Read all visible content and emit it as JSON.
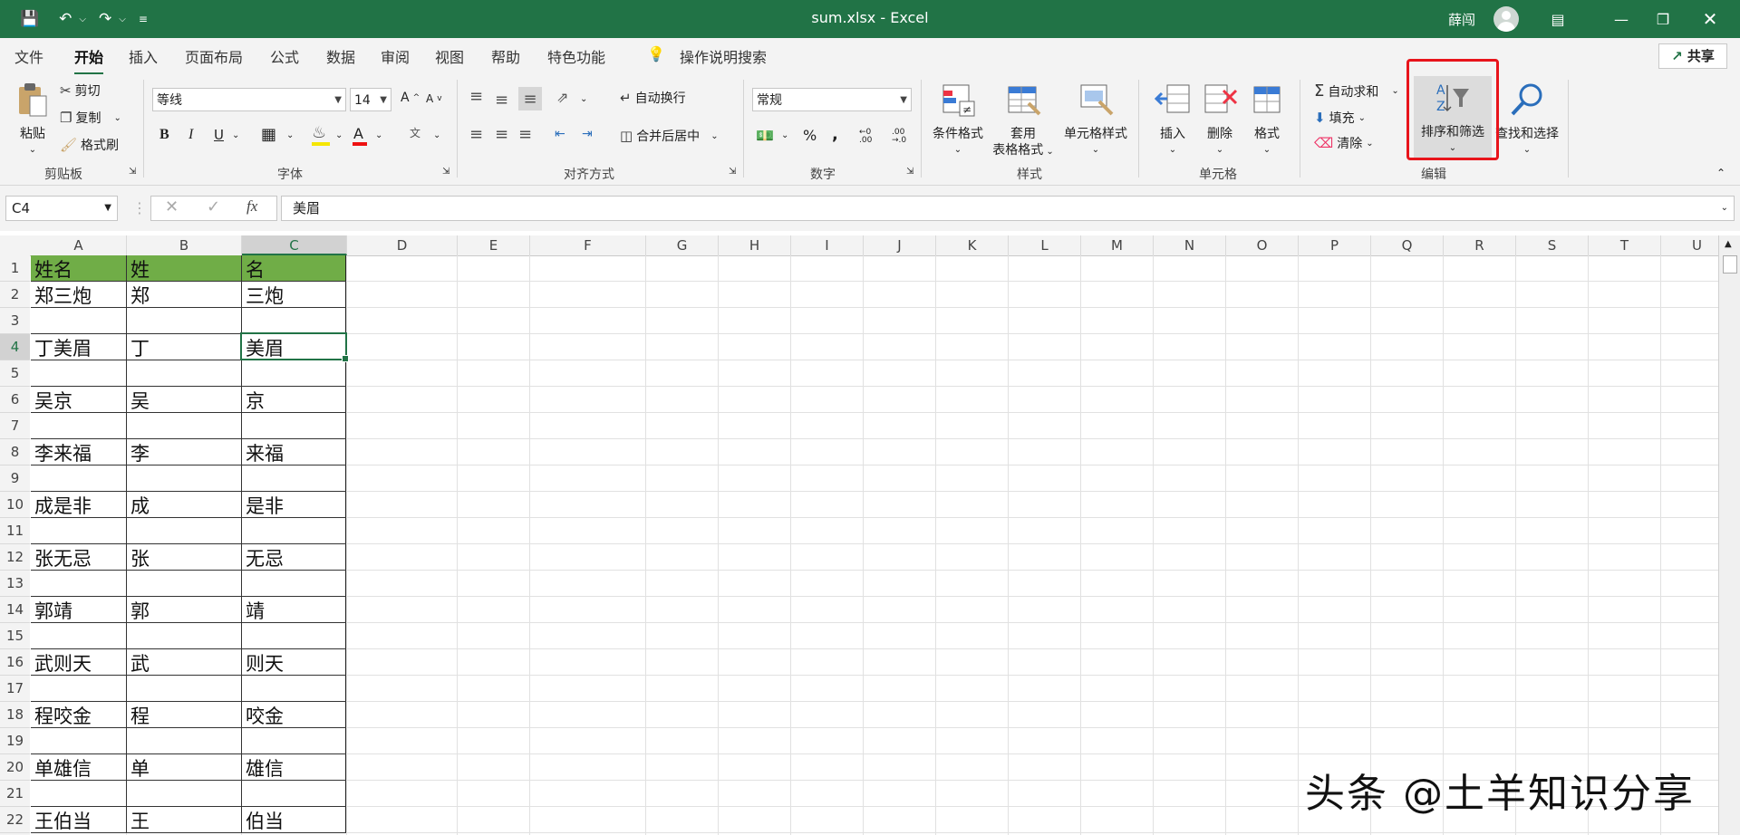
{
  "window": {
    "title": "sum.xlsx  -  Excel",
    "user": "薛闯",
    "share_label": "共享"
  },
  "menu_tabs": [
    "文件",
    "开始",
    "插入",
    "页面布局",
    "公式",
    "数据",
    "审阅",
    "视图",
    "帮助",
    "特色功能",
    "操作说明搜索"
  ],
  "ribbon": {
    "clipboard": {
      "paste": "粘贴",
      "cut": "剪切",
      "copy": "复制",
      "format_painter": "格式刷",
      "label": "剪贴板"
    },
    "font": {
      "name": "等线",
      "size": "14",
      "label": "字体"
    },
    "alignment": {
      "wrap": "自动换行",
      "merge": "合并后居中",
      "label": "对齐方式"
    },
    "number": {
      "format": "常规",
      "label": "数字"
    },
    "styles": {
      "conditional": "条件格式",
      "table_line1": "套用",
      "table_line2": "表格格式",
      "cell_styles": "单元格样式",
      "label": "样式"
    },
    "cells": {
      "insert": "插入",
      "delete": "删除",
      "format": "格式",
      "label": "单元格"
    },
    "editing": {
      "autosum": "自动求和",
      "fill": "填充",
      "clear": "清除",
      "sort_filter": "排序和筛选",
      "find_select": "查找和选择",
      "label": "编辑"
    }
  },
  "formula_bar": {
    "name_box": "C4",
    "content": "美眉"
  },
  "columns": [
    "A",
    "B",
    "C",
    "D",
    "E",
    "F",
    "G",
    "H",
    "I",
    "J",
    "K",
    "L",
    "M",
    "N",
    "O",
    "P",
    "Q",
    "R",
    "S",
    "T",
    "U"
  ],
  "rows": [
    "1",
    "2",
    "3",
    "4",
    "5",
    "6",
    "7",
    "8",
    "9",
    "10",
    "11",
    "12",
    "13",
    "14",
    "15",
    "16",
    "17",
    "18",
    "19",
    "20",
    "21",
    "22"
  ],
  "selected_cell": "C4",
  "table": [
    [
      "姓名",
      "姓",
      "名"
    ],
    [
      "郑三炮",
      "郑",
      "三炮"
    ],
    [
      "",
      "",
      ""
    ],
    [
      "丁美眉",
      "丁",
      "美眉"
    ],
    [
      "",
      "",
      ""
    ],
    [
      "吴京",
      "吴",
      "京"
    ],
    [
      "",
      "",
      ""
    ],
    [
      "李来福",
      "李",
      "来福"
    ],
    [
      "",
      "",
      ""
    ],
    [
      "成是非",
      "成",
      "是非"
    ],
    [
      "",
      "",
      ""
    ],
    [
      "张无忌",
      "张",
      "无忌"
    ],
    [
      "",
      "",
      ""
    ],
    [
      "郭靖",
      "郭",
      "靖"
    ],
    [
      "",
      "",
      ""
    ],
    [
      "武则天",
      "武",
      "则天"
    ],
    [
      "",
      "",
      ""
    ],
    [
      "程咬金",
      "程",
      "咬金"
    ],
    [
      "",
      "",
      ""
    ],
    [
      "单雄信",
      "单",
      "雄信"
    ],
    [
      "",
      "",
      ""
    ],
    [
      "王伯当",
      "王",
      "伯当"
    ]
  ],
  "colors": {
    "excel_green": "#217346",
    "header_fill": "#70ad47",
    "highlight_red": "#e8141b"
  },
  "watermark": "头条 @土羊知识分享"
}
